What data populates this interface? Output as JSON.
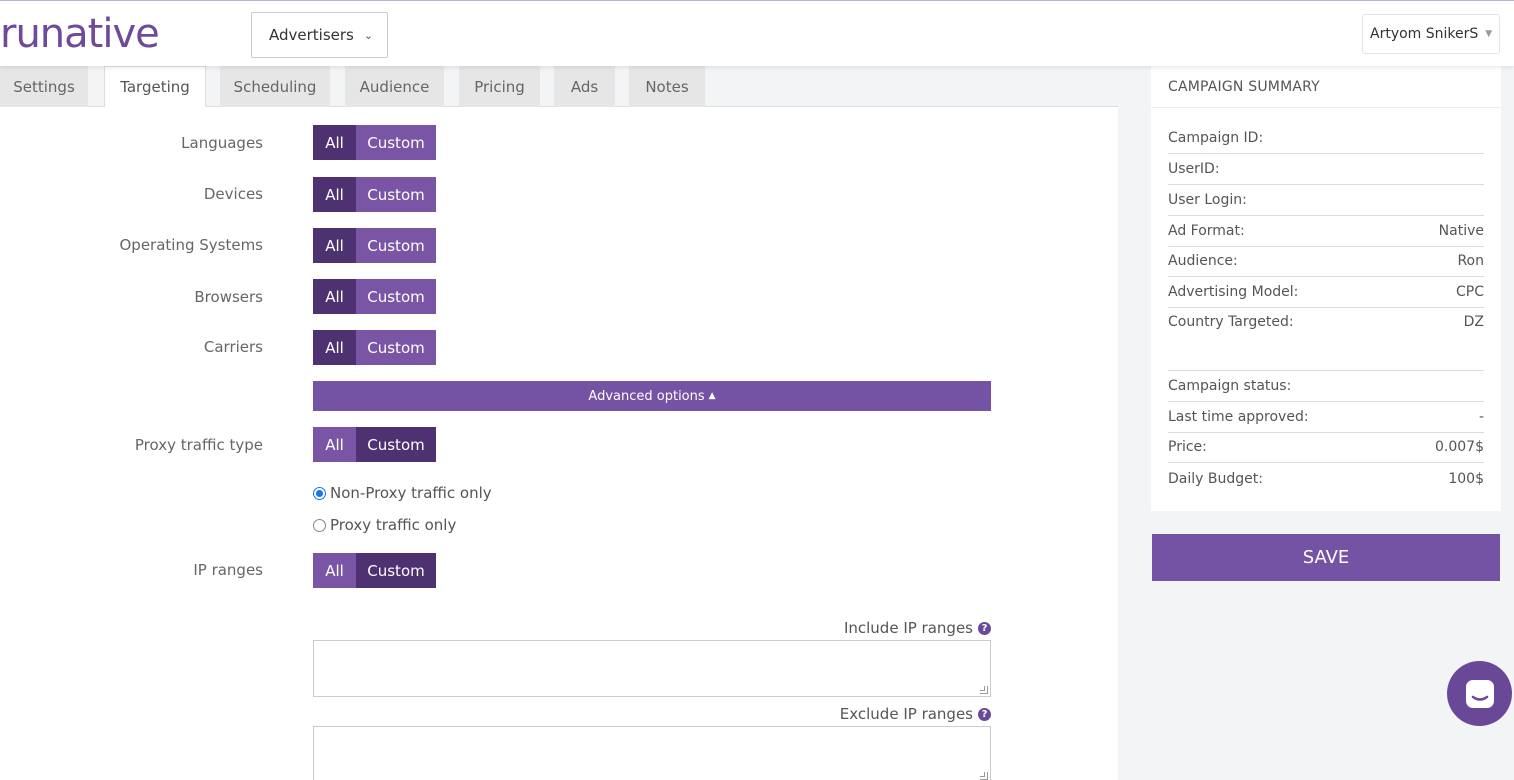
{
  "header": {
    "logo_run": "run",
    "logo_a": "a",
    "logo_tive": "tive",
    "advertisers_label": "Advertisers",
    "user_name": "Artyom SnikerS"
  },
  "tabs": [
    {
      "label": "Settings"
    },
    {
      "label": "Targeting"
    },
    {
      "label": "Scheduling"
    },
    {
      "label": "Audience"
    },
    {
      "label": "Pricing"
    },
    {
      "label": "Ads"
    },
    {
      "label": "Notes"
    }
  ],
  "active_tab": "Targeting",
  "targeting": {
    "rows": [
      {
        "label": "Languages",
        "all": "All",
        "custom": "Custom",
        "selected": "All"
      },
      {
        "label": "Devices",
        "all": "All",
        "custom": "Custom",
        "selected": "All"
      },
      {
        "label": "Operating Systems",
        "all": "All",
        "custom": "Custom",
        "selected": "All"
      },
      {
        "label": "Browsers",
        "all": "All",
        "custom": "Custom",
        "selected": "All"
      },
      {
        "label": "Carriers",
        "all": "All",
        "custom": "Custom",
        "selected": "All"
      }
    ],
    "advanced_label": "Advanced options",
    "proxy": {
      "label": "Proxy traffic type",
      "all": "All",
      "custom": "Custom",
      "selected": "Custom"
    },
    "radios": [
      {
        "label": "Non-Proxy traffic only",
        "checked": true
      },
      {
        "label": "Proxy traffic only",
        "checked": false
      }
    ],
    "ip": {
      "label": "IP ranges",
      "all": "All",
      "custom": "Custom",
      "selected": "Custom"
    },
    "include_label": "Include IP ranges",
    "exclude_label": "Exclude IP ranges",
    "include_value": "",
    "exclude_value": ""
  },
  "summary": {
    "title": "CAMPAIGN SUMMARY",
    "rows": [
      {
        "label": "Campaign ID:",
        "value": ""
      },
      {
        "label": "UserID:",
        "value": ""
      },
      {
        "label": "User Login:",
        "value": ""
      },
      {
        "label": "Ad Format:",
        "value": "Native"
      },
      {
        "label": "Audience:",
        "value": "Ron"
      },
      {
        "label": "Advertising Model:",
        "value": "CPC"
      },
      {
        "label": "Country Targeted:",
        "value": "DZ"
      },
      {
        "label": "Campaign status:",
        "value": ""
      },
      {
        "label": "Last time approved:",
        "value": "-"
      },
      {
        "label": "Price:",
        "value": "0.007$"
      },
      {
        "label": "Daily Budget:",
        "value": "100$"
      }
    ],
    "save_label": "SAVE"
  },
  "colors": {
    "brand": "#6f4a9b",
    "button_dark": "#4e3170",
    "button_light": "#7a55a6"
  }
}
